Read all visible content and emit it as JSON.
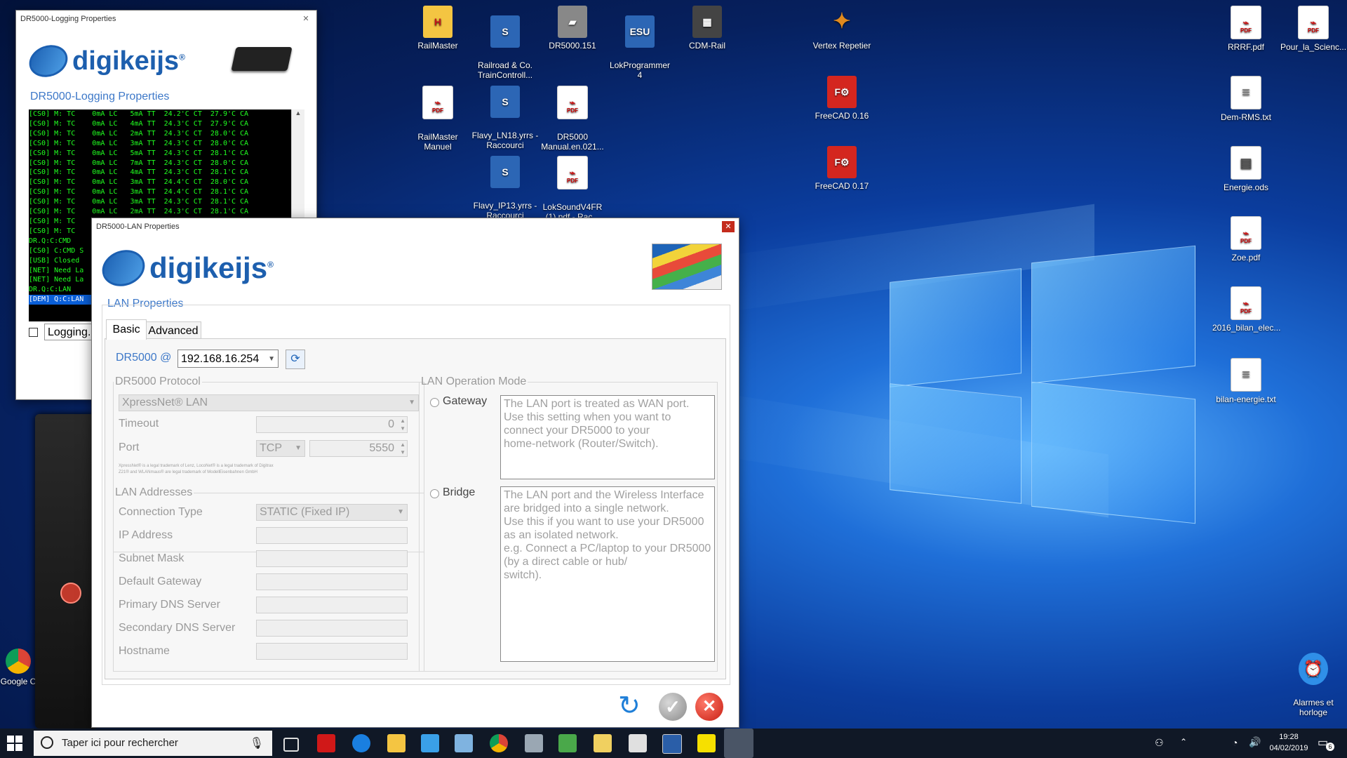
{
  "desktop": {
    "icons": [
      {
        "label": "RailMaster",
        "icon": "railmaster-icon",
        "color": "#e7a516"
      },
      {
        "label": "Railroad & Co.\nTrainControll...",
        "icon": "traincontroller-icon",
        "color": "#3c6fc8"
      },
      {
        "label": "DR5000.151",
        "icon": "dr5000-device-icon",
        "color": "#777777"
      },
      {
        "label": "LokProgrammer\n4",
        "icon": "lokprogrammer-icon",
        "color": "#1b66c9"
      },
      {
        "label": "CDM-Rail",
        "icon": "cdm-rail-icon",
        "color": "#444444"
      },
      {
        "label": "Vertex Repetier",
        "icon": "vertex-repetier-icon",
        "color": "#e08a1e"
      },
      {
        "label": "RRRF.pdf",
        "icon": "pdf-icon"
      },
      {
        "label": "Pour_la_Scienc...",
        "icon": "pdf-icon"
      },
      {
        "label": "RailMaster\nManuel",
        "icon": "pdf-icon"
      },
      {
        "label": "Flavy_LN18.yrrs -\nRaccourci",
        "icon": "traincontroller-icon",
        "color": "#3c6fc8"
      },
      {
        "label": "DR5000\nManual.en.021...",
        "icon": "pdf-icon"
      },
      {
        "label": "FreeCAD 0.16",
        "icon": "freecad-icon",
        "color": "#d4261f"
      },
      {
        "label": "Dem-RMS.txt",
        "icon": "text-file-icon"
      },
      {
        "label": "Flavy_IP13.yrrs -\nRaccourci",
        "icon": "traincontroller-icon",
        "color": "#3c6fc8"
      },
      {
        "label": "LokSoundV4FR\n(1).pdf - Rac...",
        "icon": "pdf-icon"
      },
      {
        "label": "FreeCAD 0.17",
        "icon": "freecad-icon",
        "color": "#d4261f"
      },
      {
        "label": "Energie.ods",
        "icon": "spreadsheet-icon"
      },
      {
        "label": "Zoe.pdf",
        "icon": "pdf-icon"
      },
      {
        "label": "2016_bilan_elec...",
        "icon": "pdf-icon"
      },
      {
        "label": "bilan-energie.txt",
        "icon": "text-file-icon"
      },
      {
        "label": "Alarmes et\nhorloge",
        "icon": "alarm-clock-icon",
        "color": "#2f8fe8"
      },
      {
        "label": "Google C",
        "icon": "chrome-icon"
      }
    ]
  },
  "logging_window": {
    "title": "DR5000-Logging Properties",
    "brand": "digikeijs",
    "heading": "DR5000-Logging Properties",
    "log_lines": [
      "[CS0] M: TC    0mA LC   5mA TT  24.2'C CT  27.9'C CA",
      "[CS0] M: TC    0mA LC   4mA TT  24.3'C CT  27.9'C CA",
      "[CS0] M: TC    0mA LC   2mA TT  24.3'C CT  28.0'C CA",
      "[CS0] M: TC    0mA LC   3mA TT  24.3'C CT  28.0'C CA",
      "[CS0] M: TC    0mA LC   5mA TT  24.3'C CT  28.1'C CA",
      "[CS0] M: TC    0mA LC   7mA TT  24.3'C CT  28.0'C CA",
      "[CS0] M: TC    0mA LC   4mA TT  24.3'C CT  28.1'C CA",
      "[CS0] M: TC    0mA LC   3mA TT  24.4'C CT  28.0'C CA",
      "[CS0] M: TC    0mA LC   3mA TT  24.4'C CT  28.1'C CA",
      "[CS0] M: TC    0mA LC   3mA TT  24.3'C CT  28.1'C CA",
      "[CS0] M: TC    0mA LC   2mA TT  24.3'C CT  28.1'C CA",
      "[CS0] M: TC    0mA LC   3mA TT  24.4'C CT  28.2'C CA",
      "[CS0] M: TC",
      "DR.Q:C:CMD",
      "[CS0] C:CMD S",
      "[USB] Closed",
      "[NET] Need La",
      "[NET] Need La",
      "DR.Q:C:LAN",
      "[DEM] Q:C:LAN"
    ],
    "logging_checkbox_label": "Logging."
  },
  "lan_window": {
    "title": "DR5000-LAN Properties",
    "brand": "digikeijs",
    "section_title": "LAN Properties",
    "tabs": [
      "Basic",
      "Advanced"
    ],
    "dr5000_label": "DR5000 @",
    "dr5000_ip": "192.168.16.254",
    "protocol": {
      "legend": "DR5000 Protocol",
      "value": "XpressNet® LAN",
      "timeout_label": "Timeout",
      "timeout_value": "0",
      "port_label": "Port",
      "port_type": "TCP",
      "port_value": "5550",
      "trademark_1": "XpressNet® is a legal trademark of  Lenz, LocoNet® is a legal trademark of Digitrax",
      "trademark_2": "Z21® and WLANmaus® are legal trademark of ModellEisenbahnen GmbH"
    },
    "addresses": {
      "legend": "LAN Addresses",
      "connection_type_label": "Connection Type",
      "connection_type_value": "STATIC (Fixed IP)",
      "ip_label": "IP Address",
      "subnet_label": "Subnet Mask",
      "gateway_label": "Default Gateway",
      "dns1_label": "Primary DNS Server",
      "dns2_label": "Secondary DNS Server",
      "hostname_label": "Hostname"
    },
    "mode": {
      "legend": "LAN Operation Mode",
      "gateway_label": "Gateway",
      "gateway_desc": "The LAN port is treated as WAN port.\nUse this setting when you want to\nconnect your DR5000 to your\nhome-network (Router/Switch).",
      "bridge_label": "Bridge",
      "bridge_desc": "The LAN port and the Wireless Interface\nare bridged into a single network.\nUse this if you want to use your DR5000\nas an isolated network.\ne.g. Connect a PC/laptop to your DR5000\n(by a direct cable or hub/\nswitch)."
    }
  },
  "taskbar": {
    "search_placeholder": "Taper ici pour rechercher",
    "time": "19:28",
    "date": "04/02/2019",
    "notification_count": "6"
  }
}
